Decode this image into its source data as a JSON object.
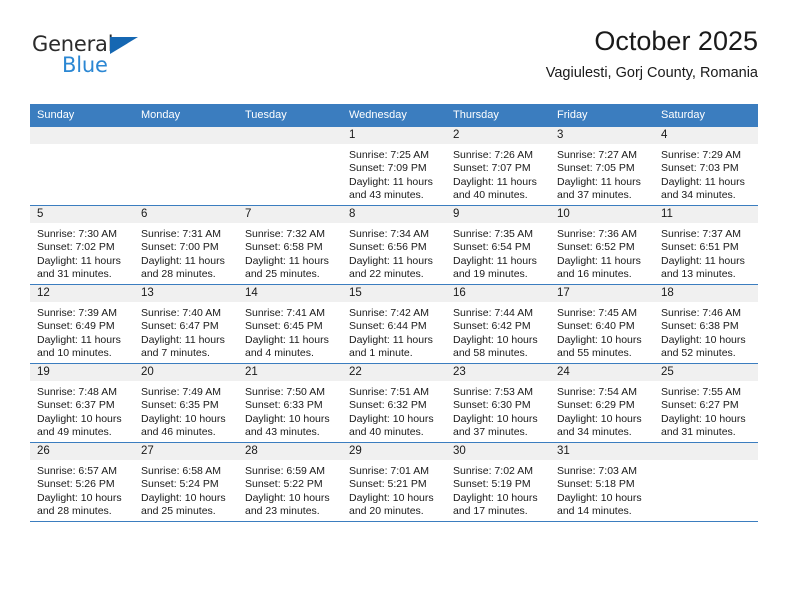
{
  "brand": {
    "name_top": "General",
    "name_bottom": "Blue",
    "triangle_color": "#1567b2",
    "blue_text_color": "#2b87d3",
    "logo_icon": "general-blue-logo"
  },
  "header": {
    "title": "October 2025",
    "subtitle": "Vagiulesti, Gorj County, Romania"
  },
  "colors": {
    "header_row_bg": "#3b7dbf",
    "header_row_text": "#ffffff",
    "daynum_band_bg": "#f0f0f0",
    "row_divider": "#3b7dbf",
    "page_bg": "#ffffff",
    "body_text": "#1a1a1a"
  },
  "weekday_headers": [
    "Sunday",
    "Monday",
    "Tuesday",
    "Wednesday",
    "Thursday",
    "Friday",
    "Saturday"
  ],
  "labels": {
    "sunrise_prefix": "Sunrise:",
    "sunset_prefix": "Sunset:",
    "daylight_prefix": "Daylight:"
  },
  "weeks": [
    [
      {
        "day": "",
        "sunrise": "",
        "sunset": "",
        "daylight_line1": "",
        "daylight_line2": "",
        "empty": true
      },
      {
        "day": "",
        "sunrise": "",
        "sunset": "",
        "daylight_line1": "",
        "daylight_line2": "",
        "empty": true
      },
      {
        "day": "",
        "sunrise": "",
        "sunset": "",
        "daylight_line1": "",
        "daylight_line2": "",
        "empty": true
      },
      {
        "day": "1",
        "sunrise": "Sunrise: 7:25 AM",
        "sunset": "Sunset: 7:09 PM",
        "daylight_line1": "Daylight: 11 hours",
        "daylight_line2": "and 43 minutes.",
        "empty": false
      },
      {
        "day": "2",
        "sunrise": "Sunrise: 7:26 AM",
        "sunset": "Sunset: 7:07 PM",
        "daylight_line1": "Daylight: 11 hours",
        "daylight_line2": "and 40 minutes.",
        "empty": false
      },
      {
        "day": "3",
        "sunrise": "Sunrise: 7:27 AM",
        "sunset": "Sunset: 7:05 PM",
        "daylight_line1": "Daylight: 11 hours",
        "daylight_line2": "and 37 minutes.",
        "empty": false
      },
      {
        "day": "4",
        "sunrise": "Sunrise: 7:29 AM",
        "sunset": "Sunset: 7:03 PM",
        "daylight_line1": "Daylight: 11 hours",
        "daylight_line2": "and 34 minutes.",
        "empty": false
      }
    ],
    [
      {
        "day": "5",
        "sunrise": "Sunrise: 7:30 AM",
        "sunset": "Sunset: 7:02 PM",
        "daylight_line1": "Daylight: 11 hours",
        "daylight_line2": "and 31 minutes.",
        "empty": false
      },
      {
        "day": "6",
        "sunrise": "Sunrise: 7:31 AM",
        "sunset": "Sunset: 7:00 PM",
        "daylight_line1": "Daylight: 11 hours",
        "daylight_line2": "and 28 minutes.",
        "empty": false
      },
      {
        "day": "7",
        "sunrise": "Sunrise: 7:32 AM",
        "sunset": "Sunset: 6:58 PM",
        "daylight_line1": "Daylight: 11 hours",
        "daylight_line2": "and 25 minutes.",
        "empty": false
      },
      {
        "day": "8",
        "sunrise": "Sunrise: 7:34 AM",
        "sunset": "Sunset: 6:56 PM",
        "daylight_line1": "Daylight: 11 hours",
        "daylight_line2": "and 22 minutes.",
        "empty": false
      },
      {
        "day": "9",
        "sunrise": "Sunrise: 7:35 AM",
        "sunset": "Sunset: 6:54 PM",
        "daylight_line1": "Daylight: 11 hours",
        "daylight_line2": "and 19 minutes.",
        "empty": false
      },
      {
        "day": "10",
        "sunrise": "Sunrise: 7:36 AM",
        "sunset": "Sunset: 6:52 PM",
        "daylight_line1": "Daylight: 11 hours",
        "daylight_line2": "and 16 minutes.",
        "empty": false
      },
      {
        "day": "11",
        "sunrise": "Sunrise: 7:37 AM",
        "sunset": "Sunset: 6:51 PM",
        "daylight_line1": "Daylight: 11 hours",
        "daylight_line2": "and 13 minutes.",
        "empty": false
      }
    ],
    [
      {
        "day": "12",
        "sunrise": "Sunrise: 7:39 AM",
        "sunset": "Sunset: 6:49 PM",
        "daylight_line1": "Daylight: 11 hours",
        "daylight_line2": "and 10 minutes.",
        "empty": false
      },
      {
        "day": "13",
        "sunrise": "Sunrise: 7:40 AM",
        "sunset": "Sunset: 6:47 PM",
        "daylight_line1": "Daylight: 11 hours",
        "daylight_line2": "and 7 minutes.",
        "empty": false
      },
      {
        "day": "14",
        "sunrise": "Sunrise: 7:41 AM",
        "sunset": "Sunset: 6:45 PM",
        "daylight_line1": "Daylight: 11 hours",
        "daylight_line2": "and 4 minutes.",
        "empty": false
      },
      {
        "day": "15",
        "sunrise": "Sunrise: 7:42 AM",
        "sunset": "Sunset: 6:44 PM",
        "daylight_line1": "Daylight: 11 hours",
        "daylight_line2": "and 1 minute.",
        "empty": false
      },
      {
        "day": "16",
        "sunrise": "Sunrise: 7:44 AM",
        "sunset": "Sunset: 6:42 PM",
        "daylight_line1": "Daylight: 10 hours",
        "daylight_line2": "and 58 minutes.",
        "empty": false
      },
      {
        "day": "17",
        "sunrise": "Sunrise: 7:45 AM",
        "sunset": "Sunset: 6:40 PM",
        "daylight_line1": "Daylight: 10 hours",
        "daylight_line2": "and 55 minutes.",
        "empty": false
      },
      {
        "day": "18",
        "sunrise": "Sunrise: 7:46 AM",
        "sunset": "Sunset: 6:38 PM",
        "daylight_line1": "Daylight: 10 hours",
        "daylight_line2": "and 52 minutes.",
        "empty": false
      }
    ],
    [
      {
        "day": "19",
        "sunrise": "Sunrise: 7:48 AM",
        "sunset": "Sunset: 6:37 PM",
        "daylight_line1": "Daylight: 10 hours",
        "daylight_line2": "and 49 minutes.",
        "empty": false
      },
      {
        "day": "20",
        "sunrise": "Sunrise: 7:49 AM",
        "sunset": "Sunset: 6:35 PM",
        "daylight_line1": "Daylight: 10 hours",
        "daylight_line2": "and 46 minutes.",
        "empty": false
      },
      {
        "day": "21",
        "sunrise": "Sunrise: 7:50 AM",
        "sunset": "Sunset: 6:33 PM",
        "daylight_line1": "Daylight: 10 hours",
        "daylight_line2": "and 43 minutes.",
        "empty": false
      },
      {
        "day": "22",
        "sunrise": "Sunrise: 7:51 AM",
        "sunset": "Sunset: 6:32 PM",
        "daylight_line1": "Daylight: 10 hours",
        "daylight_line2": "and 40 minutes.",
        "empty": false
      },
      {
        "day": "23",
        "sunrise": "Sunrise: 7:53 AM",
        "sunset": "Sunset: 6:30 PM",
        "daylight_line1": "Daylight: 10 hours",
        "daylight_line2": "and 37 minutes.",
        "empty": false
      },
      {
        "day": "24",
        "sunrise": "Sunrise: 7:54 AM",
        "sunset": "Sunset: 6:29 PM",
        "daylight_line1": "Daylight: 10 hours",
        "daylight_line2": "and 34 minutes.",
        "empty": false
      },
      {
        "day": "25",
        "sunrise": "Sunrise: 7:55 AM",
        "sunset": "Sunset: 6:27 PM",
        "daylight_line1": "Daylight: 10 hours",
        "daylight_line2": "and 31 minutes.",
        "empty": false
      }
    ],
    [
      {
        "day": "26",
        "sunrise": "Sunrise: 6:57 AM",
        "sunset": "Sunset: 5:26 PM",
        "daylight_line1": "Daylight: 10 hours",
        "daylight_line2": "and 28 minutes.",
        "empty": false
      },
      {
        "day": "27",
        "sunrise": "Sunrise: 6:58 AM",
        "sunset": "Sunset: 5:24 PM",
        "daylight_line1": "Daylight: 10 hours",
        "daylight_line2": "and 25 minutes.",
        "empty": false
      },
      {
        "day": "28",
        "sunrise": "Sunrise: 6:59 AM",
        "sunset": "Sunset: 5:22 PM",
        "daylight_line1": "Daylight: 10 hours",
        "daylight_line2": "and 23 minutes.",
        "empty": false
      },
      {
        "day": "29",
        "sunrise": "Sunrise: 7:01 AM",
        "sunset": "Sunset: 5:21 PM",
        "daylight_line1": "Daylight: 10 hours",
        "daylight_line2": "and 20 minutes.",
        "empty": false
      },
      {
        "day": "30",
        "sunrise": "Sunrise: 7:02 AM",
        "sunset": "Sunset: 5:19 PM",
        "daylight_line1": "Daylight: 10 hours",
        "daylight_line2": "and 17 minutes.",
        "empty": false
      },
      {
        "day": "31",
        "sunrise": "Sunrise: 7:03 AM",
        "sunset": "Sunset: 5:18 PM",
        "daylight_line1": "Daylight: 10 hours",
        "daylight_line2": "and 14 minutes.",
        "empty": false
      },
      {
        "day": "",
        "sunrise": "",
        "sunset": "",
        "daylight_line1": "",
        "daylight_line2": "",
        "empty": true
      }
    ]
  ]
}
